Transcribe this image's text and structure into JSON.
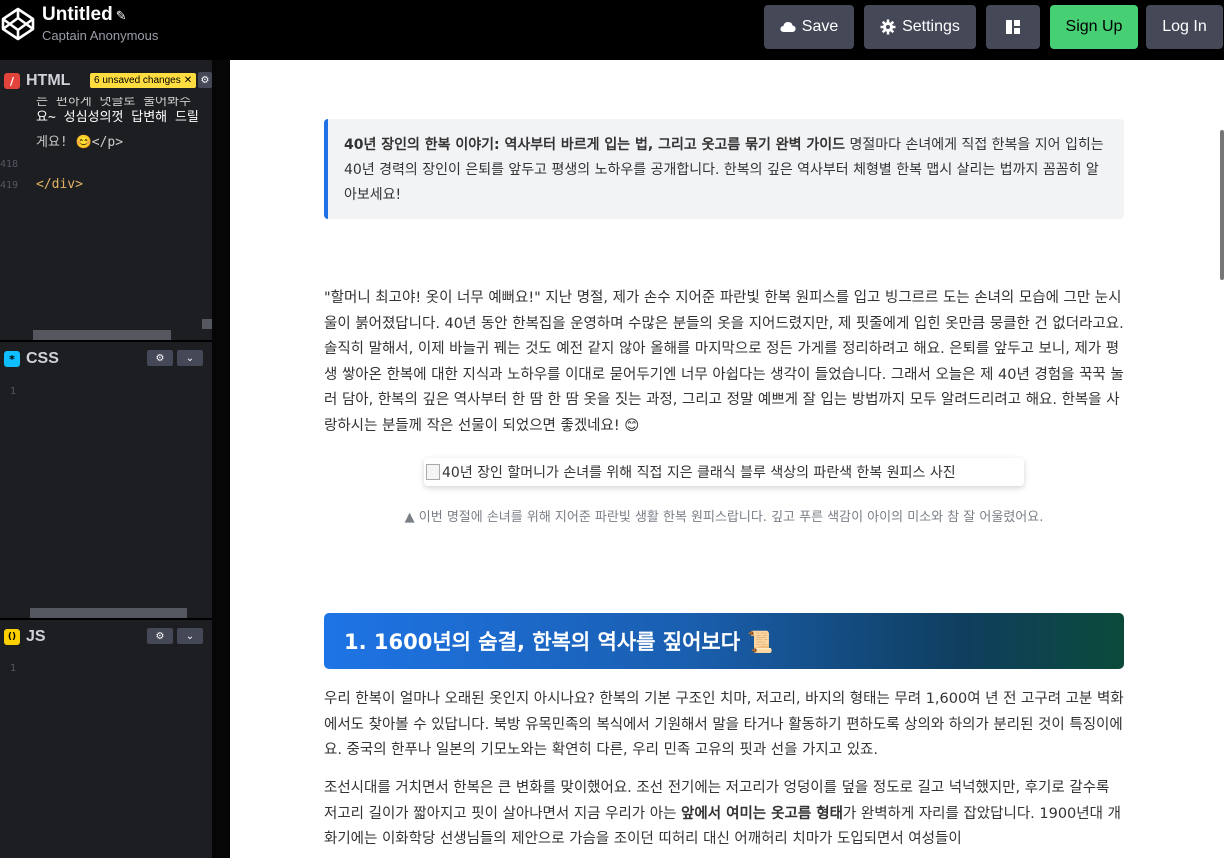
{
  "header": {
    "title": "Untitled",
    "subtitle": "Captain Anonymous",
    "buttons": {
      "save": "Save",
      "settings": "Settings",
      "signup": "Sign Up",
      "login": "Log In"
    }
  },
  "editors": {
    "html": {
      "name": "HTML",
      "badge": "/",
      "unsaved": "6 unsaved changes",
      "partial_line": "는 편하게 댓글로 물어봐주",
      "lines": [
        {
          "num": "",
          "text": "요~ 성심성의껏 답변해 드릴"
        },
        {
          "num": "",
          "text": "게요! 😊</p>"
        },
        {
          "num": "418",
          "text": ""
        },
        {
          "num": "419",
          "text": "</div>"
        }
      ]
    },
    "css": {
      "name": "CSS",
      "badge": "*",
      "line": "1"
    },
    "js": {
      "name": "JS",
      "badge": "()",
      "line": "1"
    }
  },
  "preview": {
    "callout_bold": "40년 장인의 한복 이야기: 역사부터 바르게 입는 법, 그리고 옷고름 묶기 완벽 가이드",
    "callout_text": " 명절마다 손녀에게 직접 한복을 지어 입히는 40년 경력의 장인이 은퇴를 앞두고 평생의 노하우를 공개합니다. 한복의 깊은 역사부터 체형별 한복 맵시 살리는 법까지 꼼꼼히 알아보세요!",
    "intro": "\"할머니 최고야! 옷이 너무 예뻐요!\" 지난 명절, 제가 손수 지어준 파란빛 한복 원피스를 입고 빙그르르 도는 손녀의 모습에 그만 눈시울이 붉어졌답니다. 40년 동안 한복집을 운영하며 수많은 분들의 옷을 지어드렸지만, 제 핏줄에게 입힌 옷만큼 뭉클한 건 없더라고요. 솔직히 말해서, 이제 바늘귀 꿰는 것도 예전 같지 않아 올해를 마지막으로 정든 가게를 정리하려고 해요. 은퇴를 앞두고 보니, 제가 평생 쌓아온 한복에 대한 지식과 노하우를 이대로 묻어두기엔 너무 아쉽다는 생각이 들었습니다. 그래서 오늘은 제 40년 경험을 꾹꾹 눌러 담아, 한복의 깊은 역사부터 한 땀 한 땀 옷을 짓는 과정, 그리고 정말 예쁘게 잘 입는 방법까지 모두 알려드리려고 해요. 한복을 사랑하시는 분들께 작은 선물이 되었으면 좋겠네요! 😊",
    "image_alt": "40년 장인 할머니가 손녀를 위해 직접 지은 클래식 블루 색상의 파란색 한복 원피스 사진",
    "caption": "▲ 이번 명절에 손녀를 위해 지어준 파란빛 생활 한복 원피스랍니다. 깊고 푸른 색감이 아이의 미소와 참 잘 어울렸어요.",
    "section1_title": "1. 1600년의 숨결, 한복의 역사를 짚어보다 📜",
    "p1": "우리 한복이 얼마나 오래된 옷인지 아시나요? 한복의 기본 구조인 치마, 저고리, 바지의 형태는 무려 1,600여 년 전 고구려 고분 벽화에서도 찾아볼 수 있답니다. 북방 유목민족의 복식에서 기원해서 말을 타거나 활동하기 편하도록 상의와 하의가 분리된 것이 특징이에요. 중국의 한푸나 일본의 기모노와는 확연히 다른, 우리 민족 고유의 핏과 선을 가지고 있죠.",
    "p2_a": "조선시대를 거치면서 한복은 큰 변화를 맞이했어요. 조선 전기에는 저고리가 엉덩이를 덮을 정도로 길고 넉넉했지만, 후기로 갈수록 저고리 길이가 짧아지고 핏이 살아나면서 지금 우리가 아는 ",
    "p2_bold": "앞에서 여미는 옷고름 형태",
    "p2_b": "가 완벽하게 자리를 잡았답니다. 1900년대 개화기에는 이화학당 선생님들의 제안으로 가슴을 조이던 띠허리 대신 어깨허리 치마가 도입되면서 여성들이"
  },
  "colors": {
    "header_bg": "#000000",
    "button_bg": "#444857",
    "signup_bg": "#47cf73",
    "accent_blue": "#1e72e5",
    "unsaved_yellow": "#ffdd40"
  }
}
